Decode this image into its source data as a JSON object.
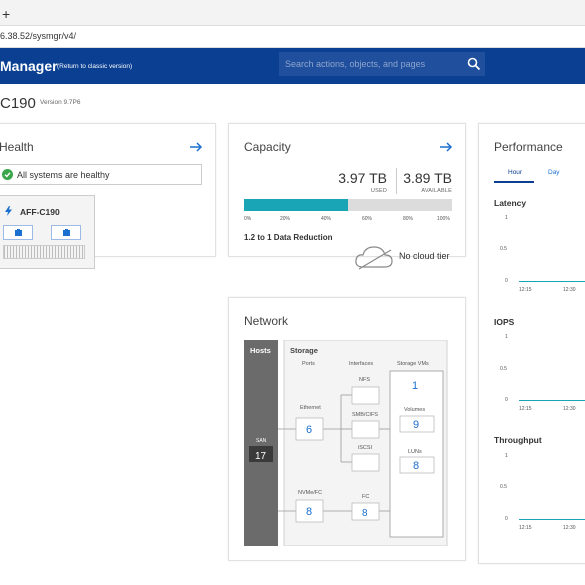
{
  "browser": {
    "new_tab_label": "+",
    "url": "6.38.52/sysmgr/v4/"
  },
  "header": {
    "app_title": "Manager",
    "classic_link": "(Return to classic version)",
    "search_placeholder": "Search actions, objects, and pages",
    "background_color": "#0a3f91"
  },
  "cluster": {
    "name": "C190",
    "version": "Version 9.7P6"
  },
  "health": {
    "title": "Health",
    "status": "All systems are healthy",
    "node_name": "AFF-C190",
    "status_color": "#3aa54a"
  },
  "capacity": {
    "title": "Capacity",
    "used_value": "3.97 TB",
    "used_label": "USED",
    "available_value": "3.89 TB",
    "available_label": "AVAILABLE",
    "used_fraction": 0.5,
    "ticks": [
      "0%",
      "20%",
      "40%",
      "60%",
      "80%",
      "100%"
    ],
    "reduction": "1.2 to 1 Data Reduction",
    "cloud_tier": "No cloud tier",
    "bar_color": "#19a5b5"
  },
  "network": {
    "title": "Network",
    "hosts_label": "Hosts",
    "san_label": "SAN",
    "san_count": "17",
    "storage_label": "Storage",
    "ports_header": "Ports",
    "interfaces_header": "Interfaces",
    "svms_header": "Storage VMs",
    "ethernet_label": "Ethernet",
    "ethernet_count": "6",
    "nvme_fc_label": "NVMe/FC",
    "nvme_fc_count": "8",
    "nfs_label": "NFS",
    "smb_label": "SMB/CIFS",
    "iscsi_label": "iSCSI",
    "fc_label": "FC",
    "fc_count": "8",
    "svm_count": "1",
    "volumes_label": "Volumes",
    "volumes_count": "9",
    "luns_label": "LUNs",
    "luns_count": "8",
    "link_color": "#1a6fcf"
  },
  "performance": {
    "title": "Performance",
    "tabs": [
      "Hour",
      "Day"
    ],
    "active_tab": "Hour",
    "metrics": [
      {
        "name": "Latency",
        "y_ticks": [
          "1",
          "0.5",
          "0"
        ],
        "x_ticks": [
          "12:15",
          "12:30"
        ]
      },
      {
        "name": "IOPS",
        "y_ticks": [
          "1",
          "0.5",
          "0"
        ],
        "x_ticks": [
          "12:15",
          "12:30"
        ]
      },
      {
        "name": "Throughput",
        "y_ticks": [
          "1",
          "0.5",
          "0"
        ],
        "x_ticks": [
          "12:15",
          "12:30"
        ]
      }
    ]
  }
}
